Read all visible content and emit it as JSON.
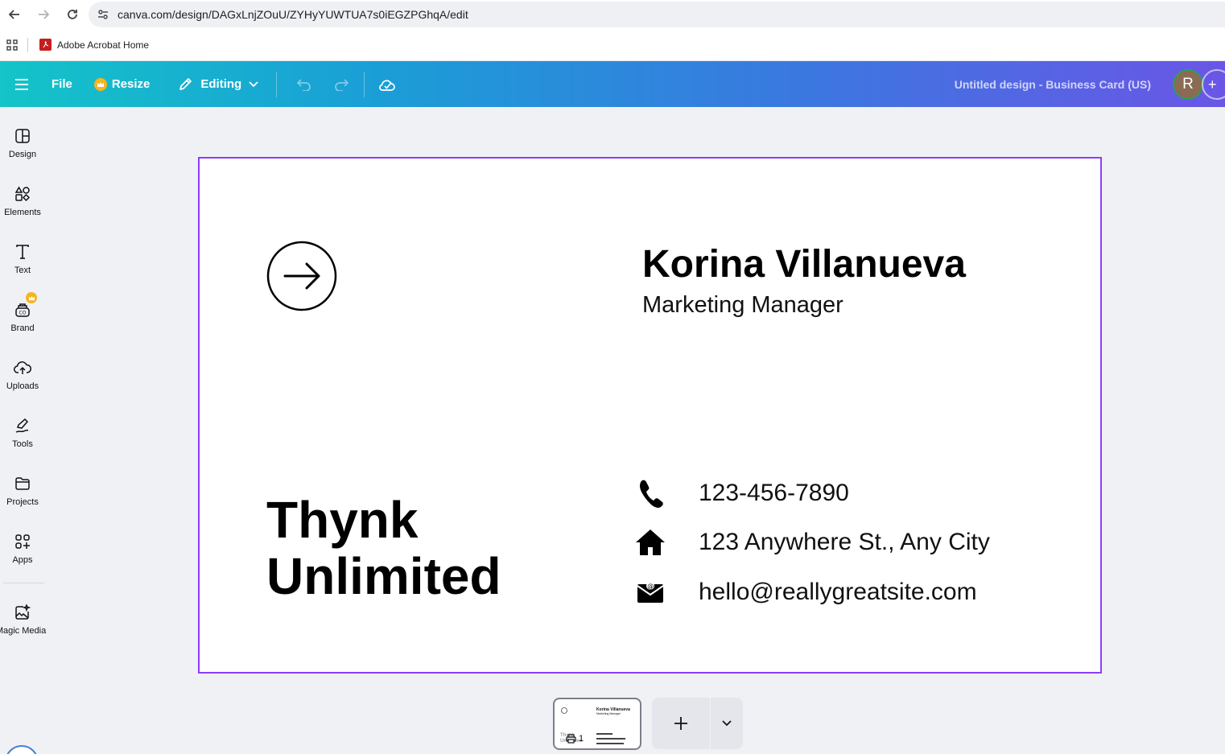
{
  "browser": {
    "url": "canva.com/design/DAGxLnjZOuU/ZYHyYUWTUA7s0iEGZPGhqA/edit",
    "bookmarks": [
      {
        "label": "Adobe Acrobat Home"
      }
    ]
  },
  "toolbar": {
    "file_label": "File",
    "resize_label": "Resize",
    "editing_label": "Editing",
    "doc_title": "Untitled design - Business Card (US)",
    "avatar_initial": "R"
  },
  "sidebar": {
    "items": [
      {
        "label": "Design",
        "icon": "design-icon"
      },
      {
        "label": "Elements",
        "icon": "elements-icon"
      },
      {
        "label": "Text",
        "icon": "text-icon"
      },
      {
        "label": "Brand",
        "icon": "brand-icon"
      },
      {
        "label": "Uploads",
        "icon": "uploads-icon"
      },
      {
        "label": "Tools",
        "icon": "tools-icon"
      },
      {
        "label": "Projects",
        "icon": "projects-icon"
      },
      {
        "label": "Apps",
        "icon": "apps-icon"
      },
      {
        "label": "Magic Media",
        "icon": "magic-media-icon"
      }
    ]
  },
  "card": {
    "name": "Korina Villanueva",
    "role": "Marketing Manager",
    "company_line1": "Thynk",
    "company_line2": "Unlimited",
    "phone": "123-456-7890",
    "address": "123 Anywhere St., Any City",
    "email": "hello@reallygreatsite.com"
  },
  "pages": {
    "current_page": "1",
    "thumb_name": "Korina Villanueva",
    "thumb_role": "Marketing Manager",
    "thumb_company": "Thynk Unlimited"
  },
  "colors": {
    "selection": "#8b3dff",
    "toolbar_start": "#14c4c8",
    "toolbar_end": "#6a56e6",
    "premium": "#f6b51e"
  }
}
